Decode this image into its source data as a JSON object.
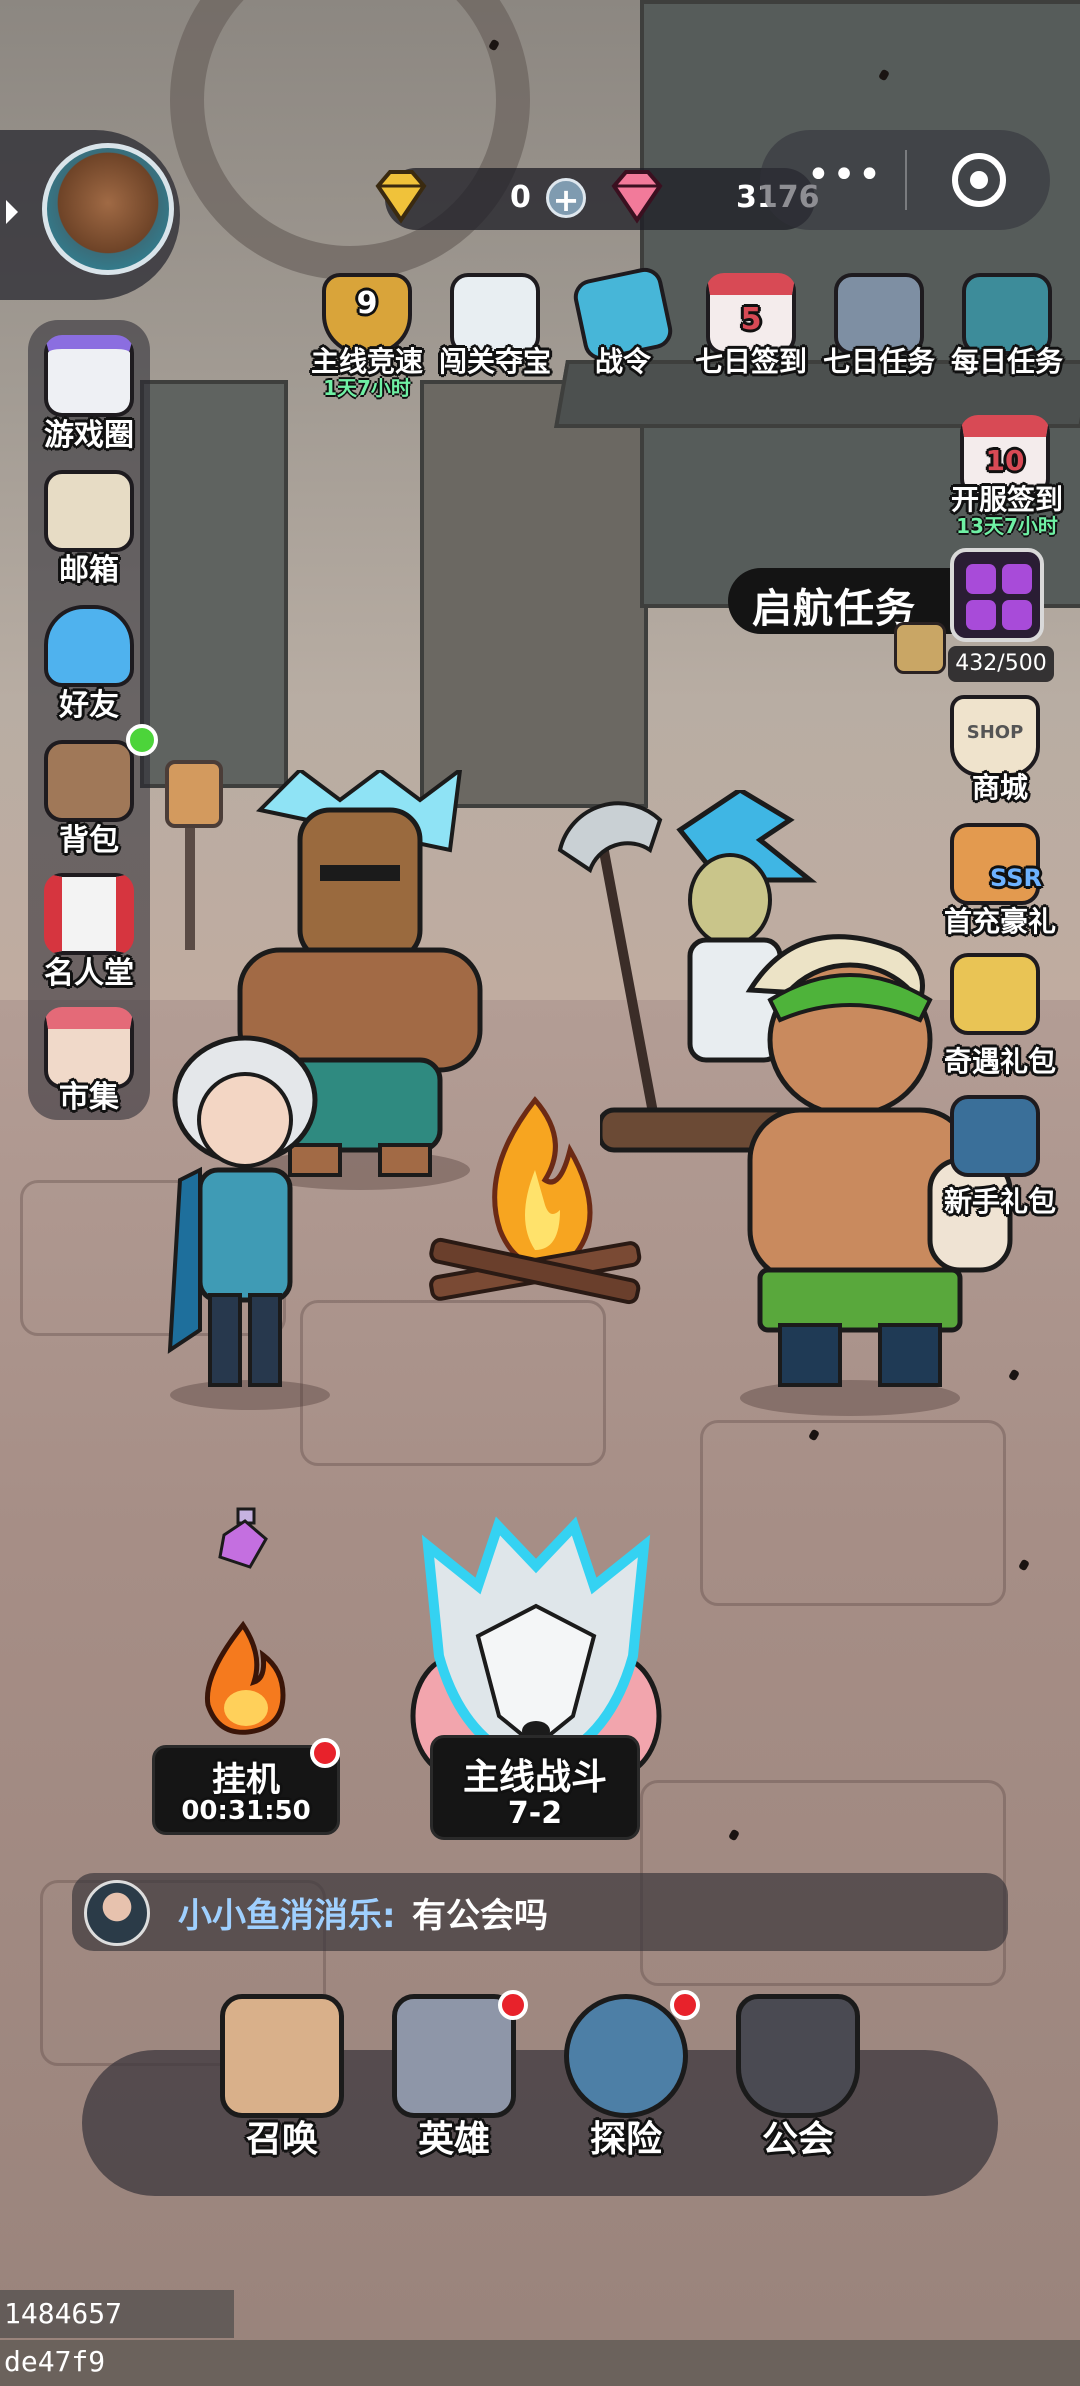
{
  "top_bar": {
    "gold_count": "0",
    "gem_count": "3176",
    "capsule_dots": "•••"
  },
  "top_icons": [
    {
      "label": "主线竞速",
      "sub": "1天7小时",
      "badge": "9"
    },
    {
      "label": "闯关夺宝"
    },
    {
      "label": "战令"
    },
    {
      "label": "七日签到",
      "badge": "5"
    },
    {
      "label": "七日任务"
    },
    {
      "label": "每日任务"
    }
  ],
  "right_icons": {
    "open_signin": {
      "label": "开服签到",
      "sub": "13天7小时",
      "badge": "10"
    },
    "quest": {
      "title": "启航任务",
      "progress": "432/500"
    },
    "shop": {
      "label": "商城",
      "badge": "SHOP"
    },
    "first_recharge": {
      "label": "首充豪礼",
      "badge": "SSR"
    },
    "encounter_pack": {
      "label": "奇遇礼包"
    },
    "newbie_pack": {
      "label": "新手礼包"
    }
  },
  "left_menu": [
    {
      "label": "游戏圈"
    },
    {
      "label": "邮箱"
    },
    {
      "label": "好友"
    },
    {
      "label": "背包"
    },
    {
      "label": "名人堂"
    },
    {
      "label": "市集"
    }
  ],
  "battle": {
    "afk_label": "挂机",
    "afk_timer": "00:31:50",
    "main_label": "主线战斗",
    "main_stage": "7-2"
  },
  "chat": {
    "name": "小小鱼消消乐:",
    "message": "有公会吗"
  },
  "bottom_nav": [
    {
      "label": "召唤"
    },
    {
      "label": "英雄"
    },
    {
      "label": "探险"
    },
    {
      "label": "公会"
    }
  ],
  "watermark": "1484657 de47f9",
  "colors": {
    "timer_green": "#6ff0a4",
    "chat_name": "#9fd0ff",
    "red_dot": "#e8222b",
    "green_dot": "#4cd43a"
  }
}
